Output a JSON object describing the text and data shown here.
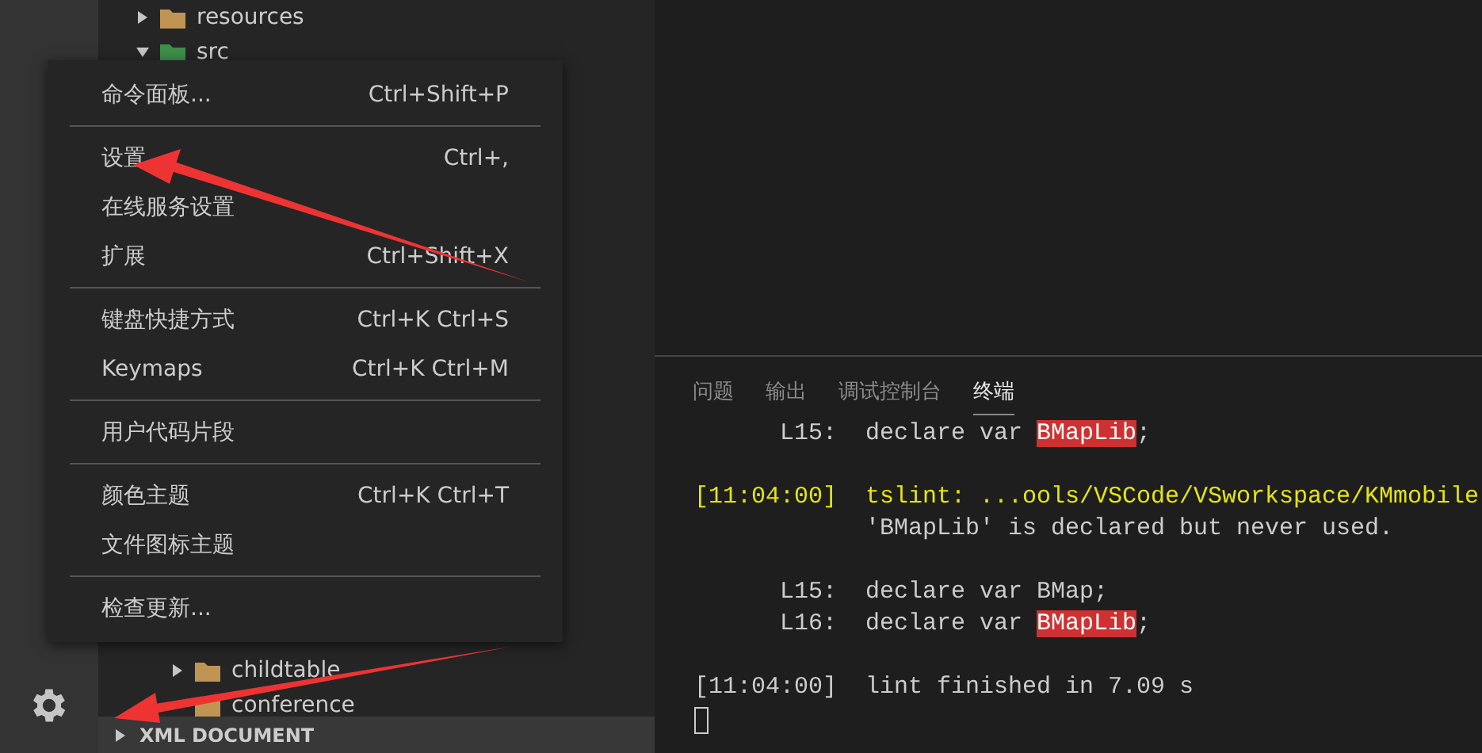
{
  "explorer": {
    "tree": [
      {
        "label": "resources",
        "kind": "folder",
        "expanded": false
      },
      {
        "label": "src",
        "kind": "source-folder",
        "expanded": true,
        "children": [
          {
            "label": "childtable",
            "kind": "folder",
            "expanded": false
          },
          {
            "label": "conference",
            "kind": "folder"
          }
        ]
      }
    ],
    "section": {
      "label": "XML DOCUMENT",
      "expanded": false
    }
  },
  "context_menu": {
    "groups": [
      [
        {
          "label": "命令面板...",
          "shortcut": "Ctrl+Shift+P"
        }
      ],
      [
        {
          "label": "设置",
          "shortcut": "Ctrl+,"
        },
        {
          "label": "在线服务设置"
        },
        {
          "label": "扩展",
          "shortcut": "Ctrl+Shift+X"
        }
      ],
      [
        {
          "label": "键盘快捷方式",
          "shortcut": "Ctrl+K Ctrl+S"
        },
        {
          "label": "Keymaps",
          "shortcut": "Ctrl+K Ctrl+M"
        }
      ],
      [
        {
          "label": "用户代码片段"
        }
      ],
      [
        {
          "label": "颜色主题",
          "shortcut": "Ctrl+K Ctrl+T"
        },
        {
          "label": "文件图标主题"
        }
      ],
      [
        {
          "label": "检查更新..."
        }
      ]
    ]
  },
  "panel": {
    "tabs": [
      {
        "label": "问题",
        "selected": false
      },
      {
        "label": "输出",
        "selected": false
      },
      {
        "label": "调试控制台",
        "selected": false
      },
      {
        "label": "终端",
        "selected": true
      }
    ],
    "terminal": [
      {
        "kind": "code",
        "gutter": "L15:",
        "segments": [
          {
            "text": "declare var ",
            "highlight": false
          },
          {
            "text": "BMapLib",
            "highlight": true
          },
          {
            "text": ";",
            "highlight": false
          }
        ]
      },
      {
        "kind": "blank"
      },
      {
        "kind": "log",
        "time": "[11:04:00]",
        "warning": true,
        "segments": [
          {
            "text": "tslint: ...ools/VSCode/VSworkspace/KMmobile",
            "highlight": false
          }
        ]
      },
      {
        "kind": "text",
        "segments": [
          {
            "text": "'BMapLib' is declared but never used.",
            "highlight": false
          }
        ]
      },
      {
        "kind": "blank"
      },
      {
        "kind": "code",
        "gutter": "L15:",
        "segments": [
          {
            "text": "declare var BMap;",
            "highlight": false
          }
        ]
      },
      {
        "kind": "code",
        "gutter": "L16:",
        "segments": [
          {
            "text": "declare var ",
            "highlight": false
          },
          {
            "text": "BMapLib",
            "highlight": true
          },
          {
            "text": ";",
            "highlight": false
          }
        ]
      },
      {
        "kind": "blank"
      },
      {
        "kind": "log",
        "time": "[11:04:00]",
        "warning": false,
        "segments": [
          {
            "text": "lint finished in 7.09 s",
            "highlight": false
          }
        ]
      },
      {
        "kind": "cursor"
      }
    ]
  }
}
